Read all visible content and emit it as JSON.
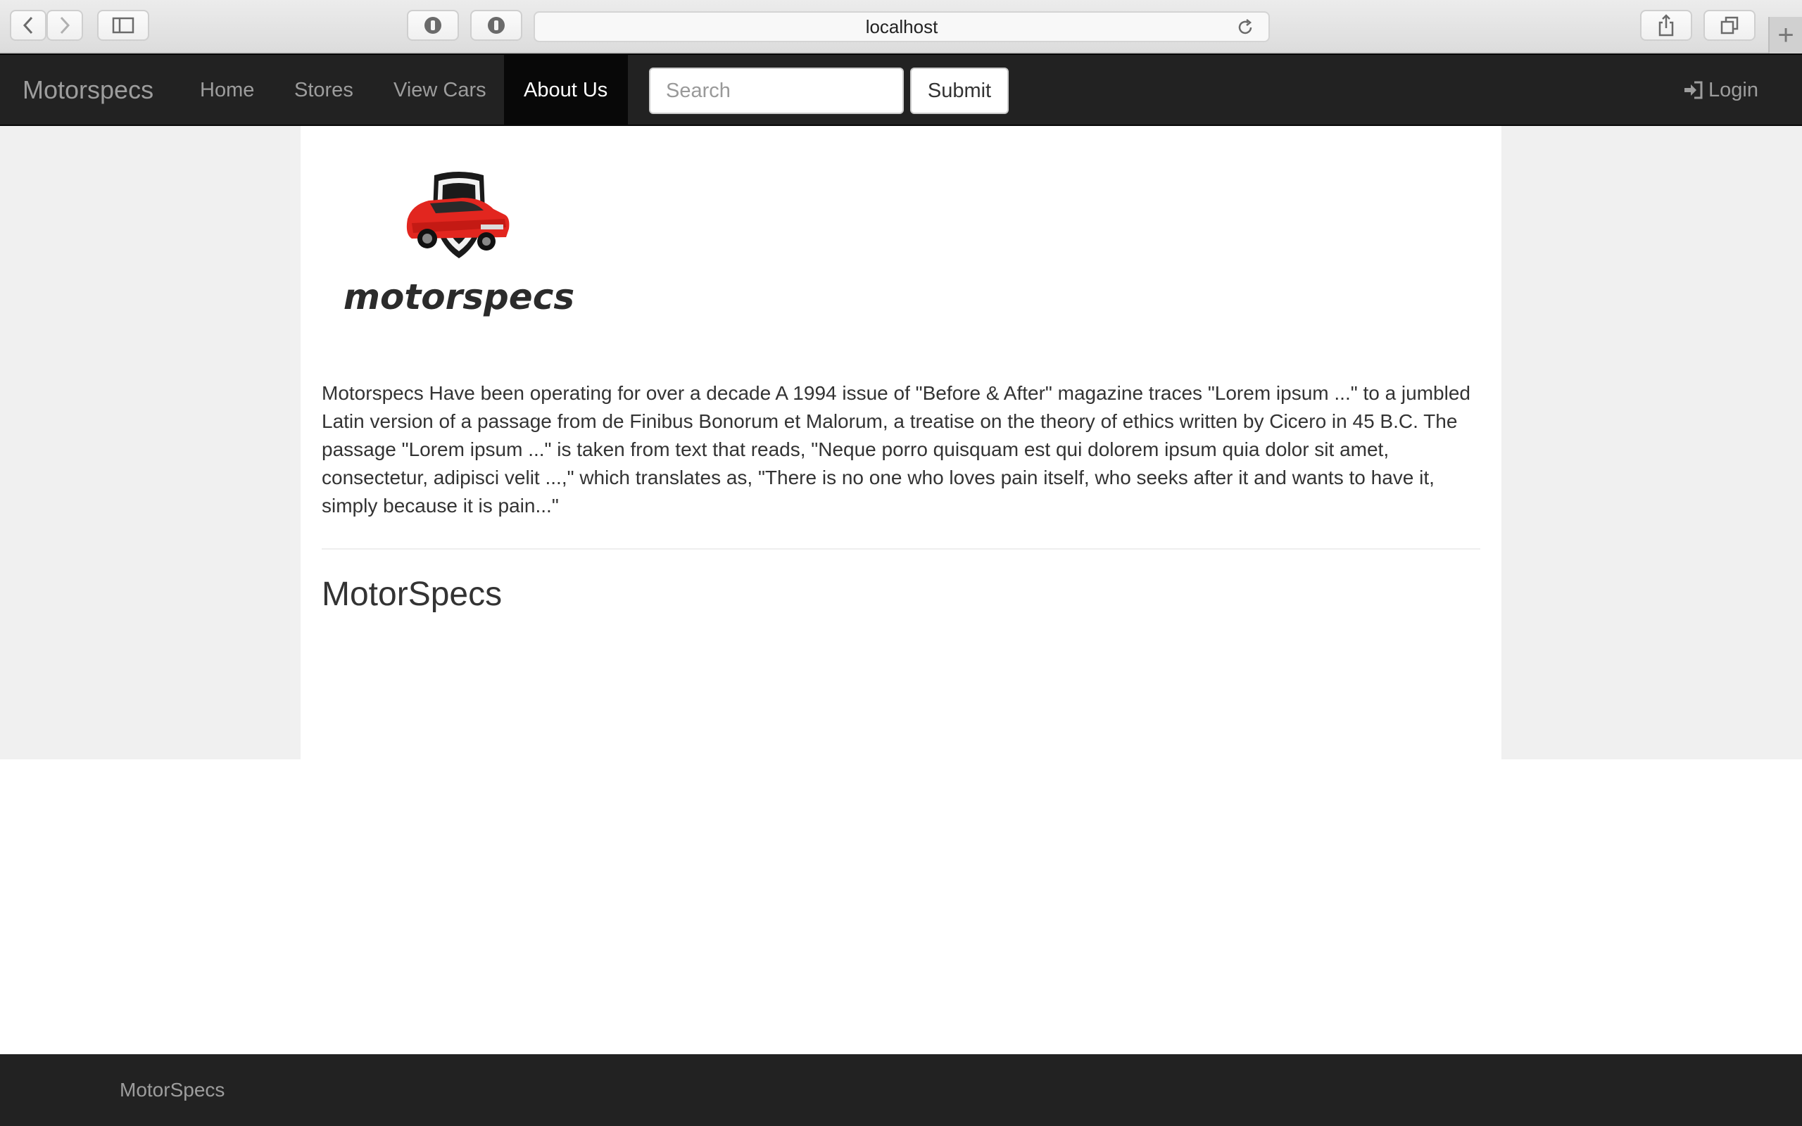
{
  "browser": {
    "url": "localhost",
    "icons": [
      "back-icon",
      "forward-icon",
      "sidebar-icon",
      "extension-icon",
      "extension-icon",
      "reload-icon",
      "share-icon",
      "tabs-icon",
      "plus-icon"
    ]
  },
  "navbar": {
    "brand": "Motorspecs",
    "links": [
      {
        "label": "Home",
        "active": false
      },
      {
        "label": "Stores",
        "active": false
      },
      {
        "label": "View Cars",
        "active": false
      },
      {
        "label": "About Us",
        "active": true
      }
    ],
    "search_placeholder": "Search",
    "submit_label": "Submit",
    "login_label": "Login",
    "login_icon": "login-icon"
  },
  "main": {
    "logo_text": "motorspecs",
    "about_text": "Motorspecs Have been operating for over a decade A 1994 issue of \"Before & After\" magazine traces \"Lorem ipsum ...\" to a jumbled Latin version of a passage from de Finibus Bonorum et Malorum, a treatise on the theory of ethics written by Cicero in 45 B.C. The passage \"Lorem ipsum ...\" is taken from text that reads, \"Neque porro quisquam est qui dolorem ipsum quia dolor sit amet, consectetur, adipisci velit ...,\" which translates as, \"There is no one who loves pain itself, who seeks after it and wants to have it, simply because it is pain...\"",
    "heading": "MotorSpecs"
  },
  "footer": {
    "text": "MotorSpecs"
  },
  "colors": {
    "navbar": "#222222",
    "active_link": "#080808",
    "page_background": "#f0f0f0",
    "car_red": "#e2261f"
  }
}
